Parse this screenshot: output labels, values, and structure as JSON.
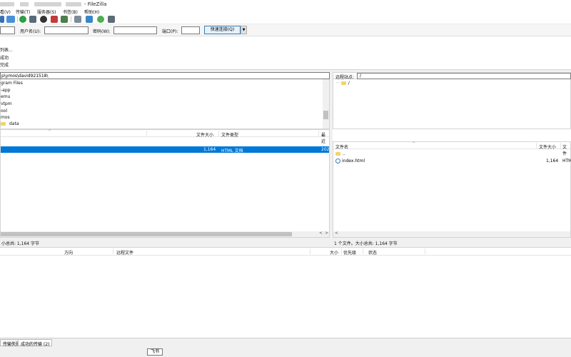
{
  "titlebar": {
    "title": "- FileZilla"
  },
  "menu": [
    "看(V)",
    "传输(T)",
    "服务器(S)",
    "书签(B)",
    "帮助(H)"
  ],
  "quickconnect": {
    "user_label": "用户名(U):",
    "password_label": "密码(W):",
    "port_label": "端口(P):",
    "button_label": "快速连接(Q)",
    "dropdown_glyph": "▼"
  },
  "log": [
    "列表...",
    "成功",
    "完成"
  ],
  "local": {
    "path": "p\\ymos\\david921518\\",
    "tree": [
      "gram Files",
      "-app",
      "emu",
      "vtpm",
      "ool",
      "mos",
      "data"
    ],
    "columns": {
      "size": "文件大小",
      "type": "文件类型",
      "modified": "最近"
    },
    "rows": [
      {
        "size": "1,164",
        "type": "HTML 文档",
        "modified": "202"
      }
    ],
    "status": "小总共: 1,164 字节"
  },
  "remote": {
    "site_label": "远程站点:",
    "path": "/",
    "tree_root": "/",
    "columns": {
      "name": "文件名",
      "size": "文件大小",
      "type": "文件"
    },
    "rows": [
      {
        "name": "..",
        "size": "",
        "type": "",
        "icon": "folder-icon"
      },
      {
        "name": "index.html",
        "size": "1,164",
        "type": "HTM",
        "icon": "html-file-icon"
      }
    ],
    "status": "1 个文件。大小总共: 1,164 字节"
  },
  "queue": {
    "columns": [
      "方向",
      "远程文件",
      "大小",
      "优先级",
      "状态"
    ]
  },
  "queue_tabs": [
    "传输失败",
    "成功的传输 (2)"
  ],
  "tooltip": "飞书",
  "colors": {
    "selection": "#0078d7",
    "accent_button": "#e5f1fb"
  }
}
